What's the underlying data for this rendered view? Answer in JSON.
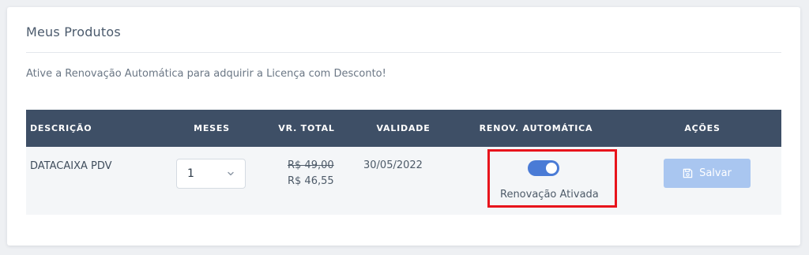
{
  "card": {
    "title": "Meus Produtos",
    "hint": "Ative a Renovação Automática para adquirir a Licença com Desconto!"
  },
  "table": {
    "headers": {
      "descricao": "DESCRIÇÃO",
      "meses": "MESES",
      "total": "VR. TOTAL",
      "validade": "VALIDADE",
      "renovacao": "RENOV. AUTOMÁTICA",
      "acoes": "AÇÕES"
    },
    "rows": [
      {
        "descricao": "DATACAIXA PDV",
        "meses": "1",
        "preco_antigo": "R$ 49,00",
        "preco_novo": "R$ 46,55",
        "validade": "30/05/2022",
        "renovacao_ativa": true,
        "renovacao_label": "Renovação Ativada",
        "acao_label": "Salvar"
      }
    ]
  },
  "colors": {
    "header_bg": "#3e4f66",
    "toggle_on": "#4a7bd6",
    "highlight_border": "#e8141c",
    "save_button_bg": "#a9c6f0"
  },
  "icons": {
    "select_chevron": "chevron-down-icon",
    "save": "floppy-disk-icon"
  }
}
